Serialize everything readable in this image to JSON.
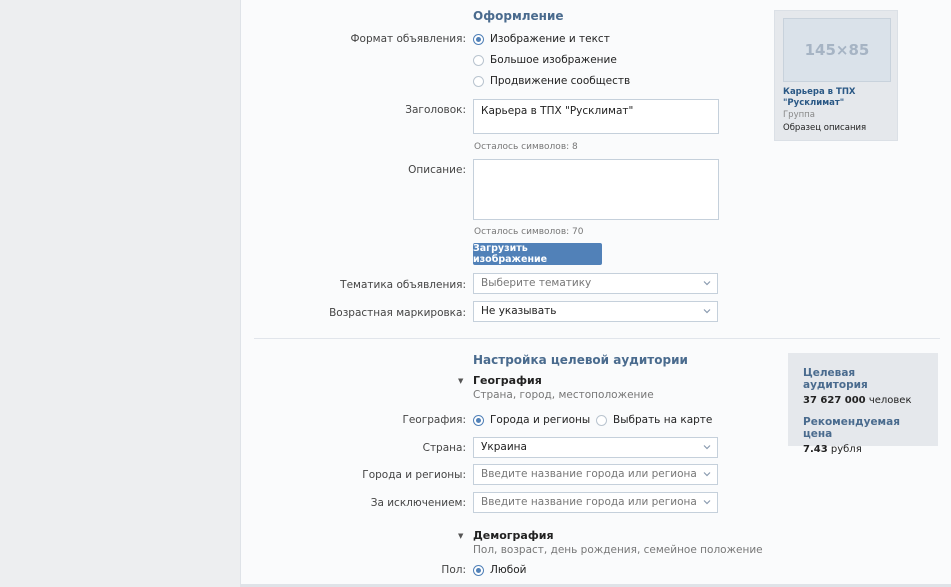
{
  "design": {
    "title": "Оформление",
    "format_label": "Формат объявления:",
    "format_options": [
      "Изображение и текст",
      "Большое изображение",
      "Продвижение сообществ"
    ],
    "headline_label": "Заголовок:",
    "headline_value": "Карьера в ТПХ \"Русклимат\"",
    "headline_hint": "Осталось символов: 8",
    "description_label": "Описание:",
    "description_value": "",
    "description_hint": "Осталось символов: 70",
    "upload_button": "Загрузить изображение",
    "topic_label": "Тематика объявления:",
    "topic_value": "Выберите тематику",
    "age_label": "Возрастная маркировка:",
    "age_value": "Не указывать"
  },
  "preview": {
    "image_placeholder": "145×85",
    "title": "Карьера в ТПХ \"Русклимат\"",
    "type": "Группа",
    "description": "Образец описания"
  },
  "audience_settings": {
    "title": "Настройка целевой аудитории",
    "geo_title": "География",
    "geo_desc": "Страна, город, местоположение",
    "geo_label": "География:",
    "geo_options": [
      "Города и регионы",
      "Выбрать на карте"
    ],
    "country_label": "Страна:",
    "country_value": "Украина",
    "cities_label": "Города и регионы:",
    "cities_placeholder": "Введите название города или региона",
    "exclude_label": "За исключением:",
    "exclude_placeholder": "Введите название города или региона",
    "demo_title": "Демография",
    "demo_desc": "Пол, возраст, день рождения, семейное положение",
    "gender_label": "Пол:",
    "gender_value": "Любой"
  },
  "audience_box": {
    "audience_title": "Целевая аудитория",
    "audience_count": "37 627 000",
    "audience_unit": "человек",
    "price_title": "Рекомендуемая цена",
    "price_value": "7.43",
    "price_unit": "рубля"
  },
  "colors": {
    "accent": "#5181b8",
    "heading": "#4a6b8e",
    "link": "#2a5885"
  }
}
